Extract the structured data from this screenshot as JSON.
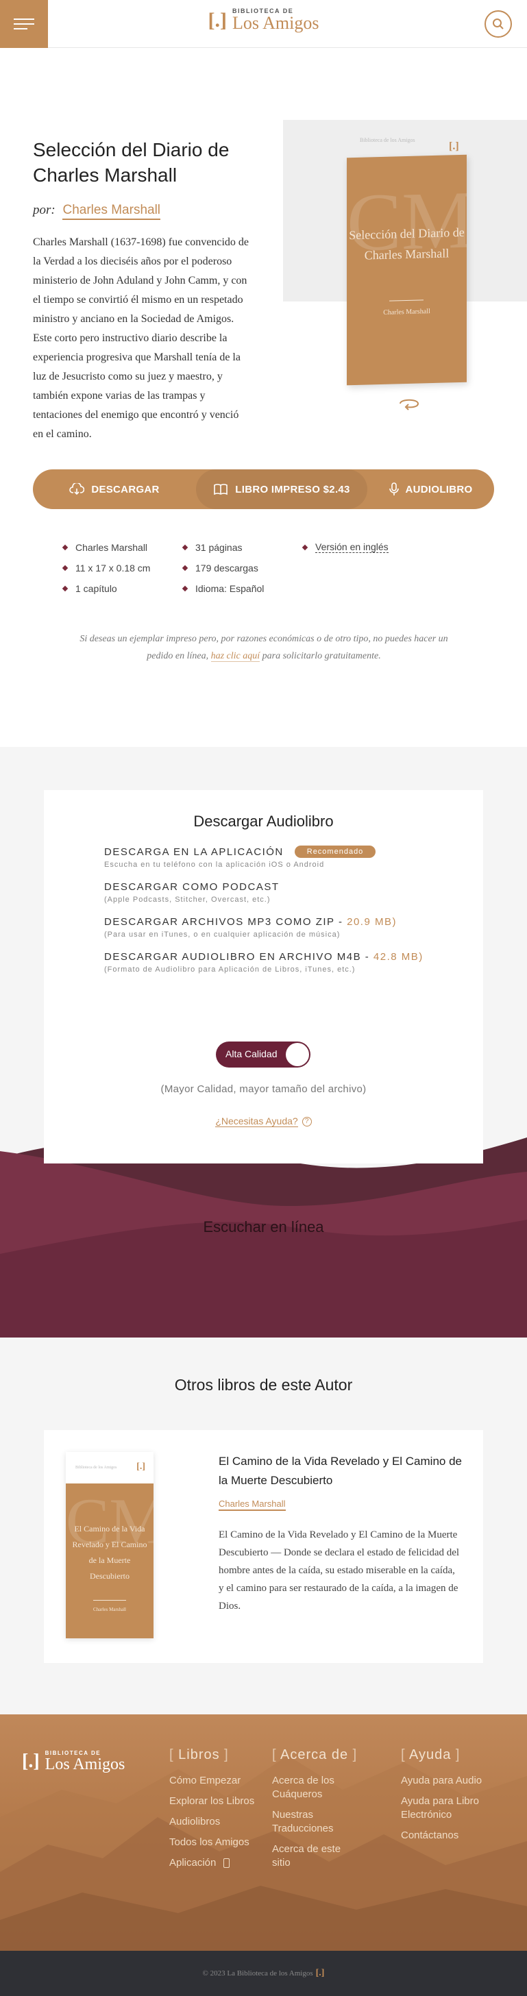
{
  "header": {
    "logo_small": "BIBLIOTECA DE",
    "logo_big": "Los Amigos",
    "logo_mark": "[.]"
  },
  "book": {
    "title": "Selección del Diario de Charles Marshall",
    "author_prefix": "por:",
    "author": "Charles Marshall",
    "description": "Charles Marshall (1637-1698) fue convencido de la Verdad a los dieciséis años por el poderoso ministerio de John Aduland y John Camm, y con el tiempo se convirtió él mismo en un respetado ministro y anciano en la Sociedad de Amigos. Este corto pero instructivo diario describe la experiencia progresiva que Marshall tenía de la luz de Jesucristo como su juez y maestro, y también expone varias de las trampas y tentaciones del enemigo que encontró y venció en el camino.",
    "cover_header": "Biblioteca de los Amigos",
    "cover_mark": "[.]",
    "cover_monogram": "CM",
    "cover_title": "Selección del Diario de Charles Marshall",
    "cover_author": "Charles Marshall"
  },
  "actions": {
    "download": "DESCARGAR",
    "print": "LIBRO IMPRESO $2.43",
    "audio": "AUDIOLIBRO"
  },
  "meta": {
    "author": "Charles Marshall",
    "pages": "31 páginas",
    "english": "Versión en inglés",
    "size": "11 x 17 x 0.18 cm",
    "downloads": "179 descargas",
    "chapters": "1 capítulo",
    "language": "Idioma: Español"
  },
  "notice": {
    "before": "Si deseas un ejemplar impreso pero, por razones económicas o de otro tipo, no puedes hacer un pedido en línea, ",
    "link": "haz clic aquí",
    "after": " para solicitarlo gratuitamente."
  },
  "audiobook": {
    "title": "Descargar Audiolibro",
    "options": [
      {
        "title": "DESCARGA EN LA APLICACIÓN",
        "badge": "Recomendado",
        "size": "",
        "sub": "Escucha en tu teléfono con la aplicación iOS o Android"
      },
      {
        "title": "DESCARGAR COMO PODCAST",
        "badge": "",
        "size": "",
        "sub": "(Apple Podcasts, Stitcher, Overcast, etc.)"
      },
      {
        "title": "DESCARGAR ARCHIVOS MP3 COMO ZIP - ",
        "badge": "",
        "size": "20.9 MB)",
        "sub": "(Para usar en iTunes, o en cualquier aplicación de música)"
      },
      {
        "title": "DESCARGAR AUDIOLIBRO EN ARCHIVO M4B - ",
        "badge": "",
        "size": "42.8 MB)",
        "sub": "(Formato de Audiolibro para Aplicación de Libros, iTunes, etc.)"
      }
    ],
    "toggle_label": "Alta Calidad",
    "quality_note": "(Mayor Calidad, mayor tamaño del archivo)",
    "help": "¿Necesitas Ayuda?",
    "help_icon": "?",
    "listen_title": "Escuchar en línea"
  },
  "others": {
    "title": "Otros libros de este Autor",
    "book": {
      "cover_header": "Biblioteca de los Amigos",
      "cover_mark": "[.]",
      "cover_monogram": "CM",
      "cover_title": "El Camino de la Vida Revelado y El Camino de la Muerte Descubierto",
      "cover_author": "Charles Marshall",
      "title": "El Camino de la Vida Revelado y El Camino de la Muerte Descubierto",
      "author": "Charles Marshall",
      "description": "El Camino de la Vida Revelado y El Camino de la Muerte Descubierto — Donde se declara el estado de felicidad del hombre antes de la caída, su estado miserable en la caída, y el camino para ser restaurado de la caída, a la imagen de Dios."
    }
  },
  "footer": {
    "logo_small": "BIBLIOTECA DE",
    "logo_big": "Los Amigos",
    "logo_mark": "[.]",
    "col1": {
      "title": "Libros",
      "links": [
        "Cómo Empezar",
        "Explorar los Libros",
        "Audiolibros",
        "Todos los Amigos",
        "Aplicación"
      ]
    },
    "col2": {
      "title": "Acerca de",
      "links": [
        "Acerca de los Cuáqueros",
        "Nuestras Traducciones",
        "Acerca de este sitio"
      ]
    },
    "col3": {
      "title": "Ayuda",
      "links": [
        "Ayuda para Audio",
        "Ayuda para Libro Electrónico",
        "Contáctanos"
      ]
    },
    "copyright": "© 2023 La Biblioteca de los Amigos",
    "copyright_mark": "[.]"
  },
  "colors": {
    "accent": "#c28c57",
    "maroon": "#6b2138",
    "footer_bar": "#2f3035"
  }
}
